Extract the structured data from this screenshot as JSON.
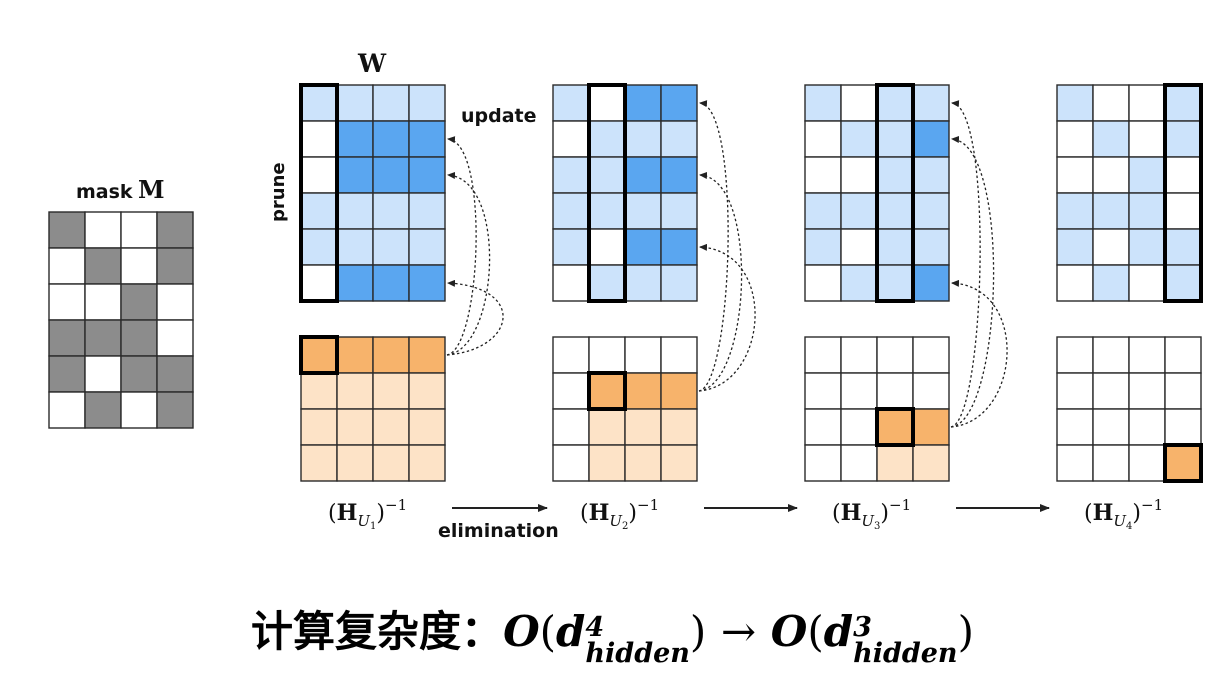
{
  "labels": {
    "mask": "mask",
    "mask_symbol": "M",
    "weights": "W",
    "update": "update",
    "prune": "prune",
    "elimination": "elimination",
    "hessian_inverse": [
      {
        "base": "(H",
        "sub": "U",
        "subsub": "1",
        "tail": ")",
        "sup": "−1"
      },
      {
        "base": "(H",
        "sub": "U",
        "subsub": "2",
        "tail": ")",
        "sup": "−1"
      },
      {
        "base": "(H",
        "sub": "U",
        "subsub": "3",
        "tail": ")",
        "sup": "−1"
      },
      {
        "base": "(H",
        "sub": "U",
        "subsub": "4",
        "tail": ")",
        "sup": "−1"
      }
    ]
  },
  "complexity": {
    "prefix": "计算复杂度：",
    "before": {
      "O": "O",
      "d": "d",
      "sup": "4",
      "sub": "hidden"
    },
    "arrow": "→",
    "after": {
      "O": "O",
      "d": "d",
      "sup": "3",
      "sub": "hidden"
    },
    "open_paren": "(",
    "close_paren": ")"
  },
  "colors": {
    "mask_on": "#8c8c8c",
    "mask_off": "#ffffff",
    "weight_light": "#cce3fb",
    "weight_strong": "#5aa6f0",
    "hessian_light": "#fde3c7",
    "hessian_strong": "#f7b36b",
    "grid_line": "#2a2a2a",
    "empty": "#ffffff"
  },
  "mask_grid": [
    [
      1,
      0,
      0,
      1
    ],
    [
      0,
      1,
      0,
      1
    ],
    [
      0,
      0,
      1,
      0
    ],
    [
      1,
      1,
      1,
      0
    ],
    [
      1,
      0,
      1,
      1
    ],
    [
      0,
      1,
      0,
      1
    ]
  ],
  "weight_grids": [
    [
      [
        1,
        1,
        1,
        1
      ],
      [
        0,
        2,
        2,
        2
      ],
      [
        0,
        2,
        2,
        2
      ],
      [
        1,
        1,
        1,
        1
      ],
      [
        1,
        1,
        1,
        1
      ],
      [
        0,
        2,
        2,
        2
      ]
    ],
    [
      [
        1,
        0,
        2,
        2
      ],
      [
        0,
        1,
        1,
        1
      ],
      [
        1,
        1,
        2,
        2
      ],
      [
        1,
        1,
        1,
        1
      ],
      [
        1,
        0,
        2,
        2
      ],
      [
        0,
        1,
        1,
        1
      ]
    ],
    [
      [
        1,
        0,
        1,
        1
      ],
      [
        0,
        1,
        1,
        2
      ],
      [
        0,
        0,
        1,
        1
      ],
      [
        1,
        1,
        1,
        1
      ],
      [
        1,
        0,
        1,
        1
      ],
      [
        0,
        1,
        1,
        2
      ]
    ],
    [
      [
        1,
        0,
        0,
        1
      ],
      [
        0,
        1,
        0,
        1
      ],
      [
        0,
        0,
        1,
        0
      ],
      [
        1,
        1,
        1,
        0
      ],
      [
        1,
        0,
        1,
        1
      ],
      [
        0,
        1,
        0,
        1
      ]
    ]
  ],
  "hessian_grids": [
    [
      [
        2,
        2,
        2,
        2
      ],
      [
        1,
        1,
        1,
        1
      ],
      [
        1,
        1,
        1,
        1
      ],
      [
        1,
        1,
        1,
        1
      ]
    ],
    [
      [
        0,
        0,
        0,
        0
      ],
      [
        0,
        2,
        2,
        2
      ],
      [
        0,
        1,
        1,
        1
      ],
      [
        0,
        1,
        1,
        1
      ]
    ],
    [
      [
        0,
        0,
        0,
        0
      ],
      [
        0,
        0,
        0,
        0
      ],
      [
        0,
        0,
        2,
        2
      ],
      [
        0,
        0,
        1,
        1
      ]
    ],
    [
      [
        0,
        0,
        0,
        0
      ],
      [
        0,
        0,
        0,
        0
      ],
      [
        0,
        0,
        0,
        0
      ],
      [
        0,
        0,
        0,
        2
      ]
    ]
  ],
  "pruned_column": [
    0,
    1,
    2,
    3
  ],
  "pivot_cell": [
    0,
    1,
    2,
    3
  ],
  "update_arrows": [
    [
      1,
      2,
      5
    ],
    [
      0,
      2,
      4
    ],
    [
      0,
      1,
      5
    ]
  ]
}
